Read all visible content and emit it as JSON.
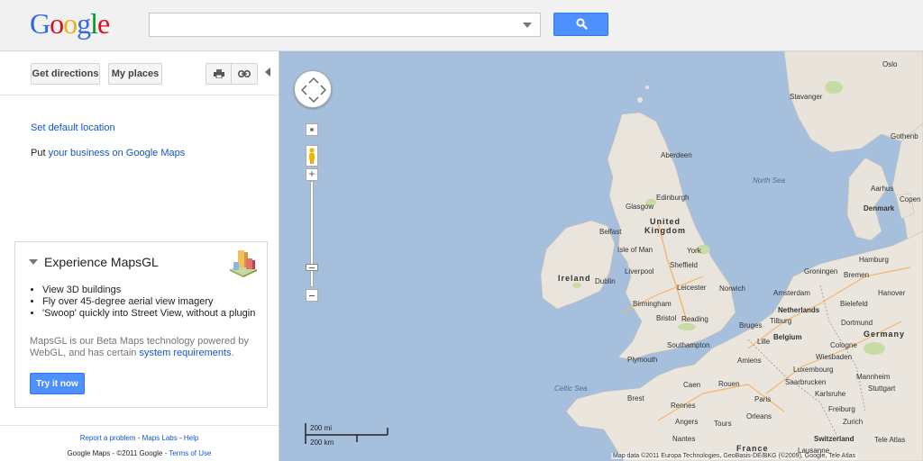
{
  "header": {
    "logo_letters": [
      {
        "ch": "G",
        "color": "#3369e8"
      },
      {
        "ch": "o",
        "color": "#d50f25"
      },
      {
        "ch": "o",
        "color": "#eeb211"
      },
      {
        "ch": "g",
        "color": "#3369e8"
      },
      {
        "ch": "l",
        "color": "#009925"
      },
      {
        "ch": "e",
        "color": "#d50f25"
      }
    ],
    "search_value": "",
    "search_button_icon": "search-icon"
  },
  "panel": {
    "get_directions": "Get directions",
    "my_places": "My places",
    "print_icon": "print-icon",
    "link_icon": "link-icon",
    "set_default_location": "Set default location",
    "business_prefix": "Put ",
    "business_link": "your business on Google Maps",
    "mapsgl": {
      "title": "Experience MapsGL",
      "bullets": [
        "View 3D buildings",
        "Fly over 45-degree aerial view imagery",
        "'Swoop' quickly into Street View, without a plugin"
      ],
      "desc_prefix": "MapsGL is our Beta Maps technology powered by WebGL, and has certain ",
      "desc_link": "system requirements",
      "desc_suffix": ".",
      "try_button": "Try it now"
    },
    "footer": {
      "report": "Report a problem",
      "sep1": " - ",
      "labs": "Maps Labs",
      "sep2": " - ",
      "help": "Help",
      "copyright": "Google Maps - ©2011 Google - ",
      "terms": "Terms of Use"
    }
  },
  "map": {
    "labels": {
      "oslo": "Oslo",
      "stavanger": "Stavanger",
      "gothenburg": "Gothenb",
      "aberdeen": "Aberdeen",
      "north_sea": "North Sea",
      "edinburgh": "Edinburgh",
      "glasgow": "Glasgow",
      "united_kingdom_1": "United",
      "united_kingdom_2": "Kingdom",
      "belfast": "Belfast",
      "isle_of_man": "Isle of Man",
      "york": "York",
      "denmark": "Denmark",
      "aarhus": "Aarhus",
      "copenhagen": "Copen",
      "ireland": "Ireland",
      "dublin": "Dublin",
      "liverpool": "Liverpool",
      "sheffield": "Sheffield",
      "leicester": "Leicester",
      "norwich": "Norwich",
      "birmingham": "Birmingham",
      "bristol": "Bristol",
      "reading": "Reading",
      "southampton": "Southampton",
      "plymouth": "Plymouth",
      "celtic_sea": "Celtic Sea",
      "hamburg": "Hamburg",
      "groningen": "Groningen",
      "bremen": "Bremen",
      "amsterdam": "Amsterdam",
      "hanover": "Hanover",
      "netherlands": "Netherlands",
      "bielefeld": "Bielefeld",
      "tilburg": "Tilburg",
      "dortmund": "Dortmund",
      "bruges": "Bruges",
      "germany": "Germany",
      "lille": "Lille",
      "belgium": "Belgium",
      "cologne": "Cologne",
      "wiesbaden": "Wiesbaden",
      "amiens": "Amiens",
      "luxembourg": "Luxembourg",
      "mannheim": "Mannheim",
      "caen": "Caen",
      "rouen": "Rouen",
      "saarbrucken": "Saarbrucken",
      "stuttgart": "Stuttgart",
      "paris": "Paris",
      "karlsruhe": "Karlsruhe",
      "brest": "Brest",
      "orleans": "Orleans",
      "rennes": "Rennes",
      "tours": "Tours",
      "angers": "Angers",
      "freiburg": "Freiburg",
      "zurich": "Zurich",
      "nantes": "Nantes",
      "switzerland": "Switzerland",
      "france": "France",
      "lausanne": "Lausanne",
      "tele_atlas": "Tele Atlas"
    },
    "scale_mi": "200 mi",
    "scale_km": "200 km",
    "attribution": "Map data ©2011 Europa Technologies, GeoBasis-DE/BKG (©2009), Google, Tele Atlas"
  }
}
